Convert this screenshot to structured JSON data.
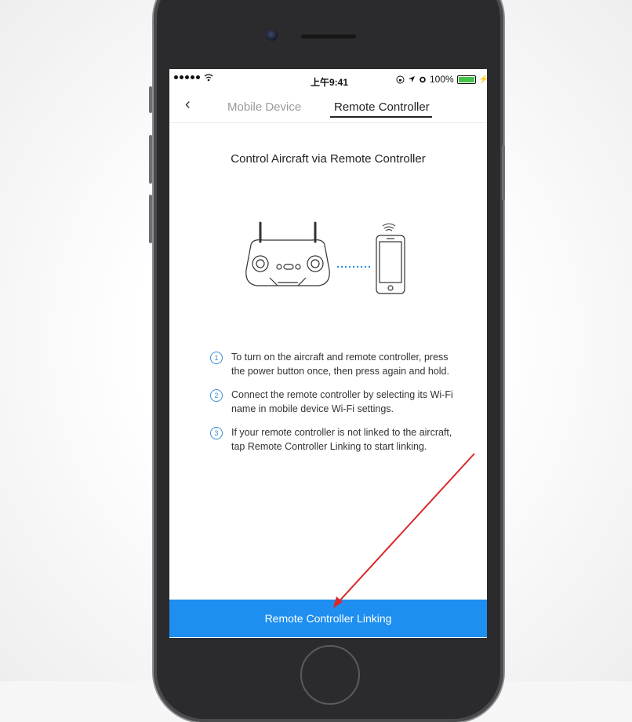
{
  "status_bar": {
    "signal_dots": "•••••",
    "time": "上午9:41",
    "battery": "100%"
  },
  "nav": {
    "back_icon": "chevron-left-icon",
    "tabs": [
      {
        "label": "Mobile Device",
        "active": false
      },
      {
        "label": "Remote Controller",
        "active": true
      }
    ]
  },
  "heading": "Control Aircraft via Remote Controller",
  "steps": [
    {
      "num": "1",
      "text": "To turn on the aircraft and remote controller, press the power button once, then press again and hold."
    },
    {
      "num": "2",
      "text": "Connect the remote controller by selecting its Wi-Fi name in mobile device Wi-Fi settings."
    },
    {
      "num": "3",
      "text": "If your remote controller is not linked to the aircraft, tap Remote Controller Linking to start linking."
    }
  ],
  "action_button": "Remote Controller Linking",
  "colors": {
    "accent": "#1e8ff0",
    "step_circle": "#3a8fd8",
    "annotation_arrow": "#d9282a",
    "battery": "#46c34a"
  }
}
